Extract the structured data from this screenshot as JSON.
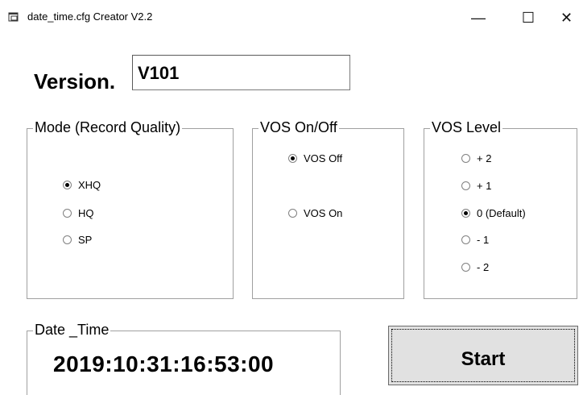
{
  "window": {
    "title": "date_time.cfg Creator V2.2",
    "icon": "app-window-icon",
    "minimize_glyph": "—",
    "maximize_glyph": "☐",
    "close_glyph": "✕"
  },
  "version": {
    "label": "Version.",
    "value": "V101"
  },
  "mode_group": {
    "title": "Mode (Record Quality)",
    "options": [
      {
        "label": "XHQ",
        "checked": true
      },
      {
        "label": "HQ",
        "checked": false
      },
      {
        "label": "SP",
        "checked": false
      }
    ]
  },
  "vos_onoff_group": {
    "title": "VOS On/Off",
    "options": [
      {
        "label": "VOS Off",
        "checked": true
      },
      {
        "label": "VOS On",
        "checked": false
      }
    ]
  },
  "vos_level_group": {
    "title": "VOS Level",
    "options": [
      {
        "label": "+ 2",
        "checked": false
      },
      {
        "label": "+ 1",
        "checked": false
      },
      {
        "label": "0 (Default)",
        "checked": true
      },
      {
        "label": "- 1",
        "checked": false
      },
      {
        "label": "- 2",
        "checked": false
      }
    ]
  },
  "datetime_group": {
    "title": "Date _Time",
    "value": "2019:10:31:16:53:00"
  },
  "start_button": {
    "label": "Start"
  }
}
